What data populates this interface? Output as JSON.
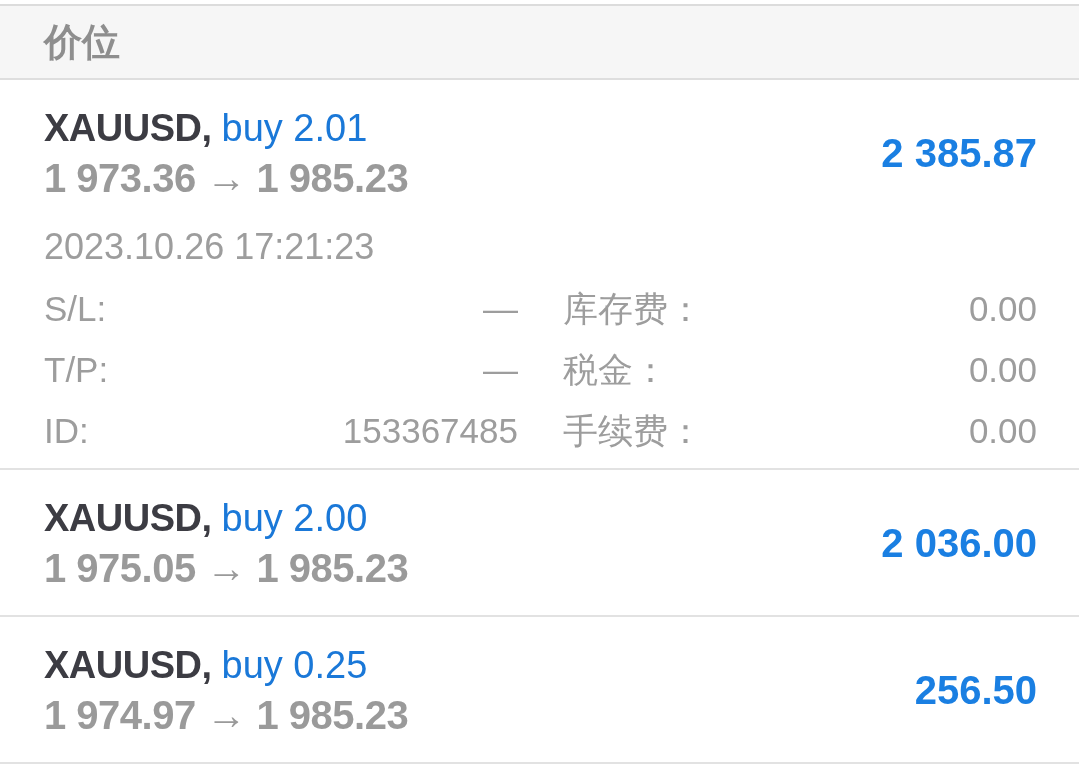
{
  "header": {
    "title": "价位"
  },
  "positions": [
    {
      "symbol": "XAUUSD,",
      "order": "buy 2.01",
      "prices": "1 973.36 → 1 985.23",
      "profit": "2 385.87",
      "time": "2023.10.26 17:21:23",
      "details": [
        {
          "label": "S/L:",
          "value": "—"
        },
        {
          "label": "库存费：",
          "value": "0.00"
        },
        {
          "label": "T/P:",
          "value": "—"
        },
        {
          "label": "税金：",
          "value": "0.00"
        },
        {
          "label": "ID:",
          "value": "153367485"
        },
        {
          "label": "手续费：",
          "value": "0.00"
        }
      ]
    },
    {
      "symbol": "XAUUSD,",
      "order": "buy 2.00",
      "prices": "1 975.05 → 1 985.23",
      "profit": "2 036.00"
    },
    {
      "symbol": "XAUUSD,",
      "order": "buy 0.25",
      "prices": "1 974.97 → 1 985.23",
      "profit": "256.50"
    }
  ]
}
